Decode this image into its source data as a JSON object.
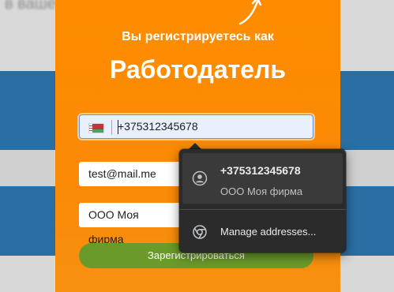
{
  "background": {
    "partial_text": "в ваше",
    "stripe_color": "#2a6fa3",
    "card_color": "#ff8a00"
  },
  "form": {
    "subtitle": "Вы регистрируетесь как",
    "title": "Работодатель",
    "phone": {
      "country_flag": "belarus-flag-icon",
      "value": "+375312345678"
    },
    "email": {
      "value": "test@mail.me"
    },
    "company": {
      "value": "ООО Моя фирма"
    },
    "register_label": "Зарегистрироваться",
    "register_color": "#6a9a2a"
  },
  "autofill_popup": {
    "suggestion": {
      "icon": "person-icon",
      "title": "+375312345678",
      "subtitle": "ООО Моя фирма"
    },
    "manage": {
      "icon": "chrome-icon",
      "label": "Manage addresses..."
    },
    "background_color": "#2b2b2b"
  }
}
